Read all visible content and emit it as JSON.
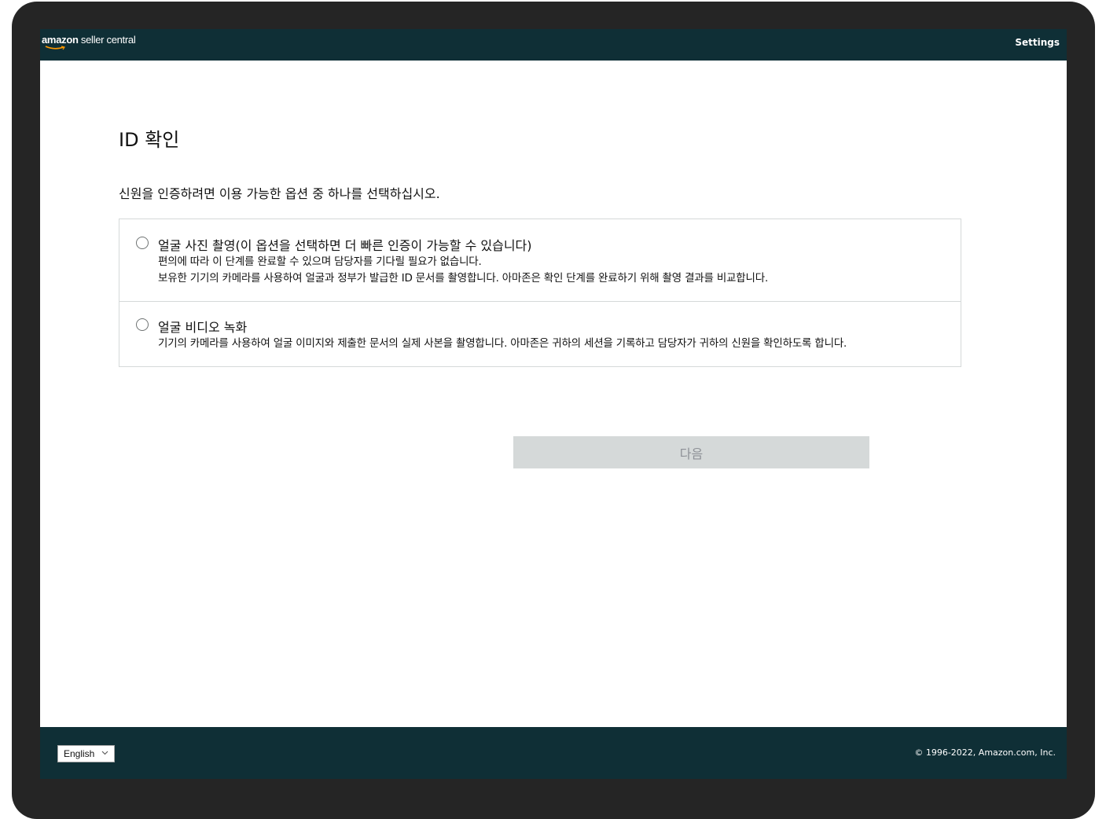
{
  "header": {
    "logo_brand": "amazon",
    "logo_product": " seller central",
    "settings_label": "Settings"
  },
  "main": {
    "title": "ID 확인",
    "subtitle": "신원을 인증하려면 이용 가능한 옵션 중 하나를 선택하십시오.",
    "options": [
      {
        "title": "얼굴 사진 촬영(이 옵션을 선택하면 더 빠른 인증이 가능할 수 있습니다)",
        "description": [
          "편의에 따라 이 단계를 완료할 수 있으며 담당자를 기다릴 필요가 없습니다.",
          "보유한 기기의 카메라를 사용하여 얼굴과 정부가 발급한 ID 문서를 촬영합니다. 아마존은 확인 단계를 완료하기 위해 촬영 결과를 비교합니다."
        ],
        "selected": false
      },
      {
        "title": "얼굴 비디오 녹화",
        "description": [
          "기기의 카메라를 사용하여 얼굴 이미지와 제출한 문서의 실제 사본을 촬영합니다. 아마존은 귀하의 세션을 기록하고 담당자가 귀하의 신원을 확인하도록 합니다."
        ],
        "selected": false
      }
    ],
    "next_button_label": "다음",
    "next_button_disabled": true
  },
  "footer": {
    "language_selected": "English",
    "copyright": "© 1996-2022, Amazon.com, Inc."
  },
  "colors": {
    "header_bg": "#0f2f36",
    "frame": "#252525",
    "disabled_button_bg": "#d5d9d9",
    "disabled_button_text": "#8d9096",
    "border": "#d5d9d9"
  }
}
